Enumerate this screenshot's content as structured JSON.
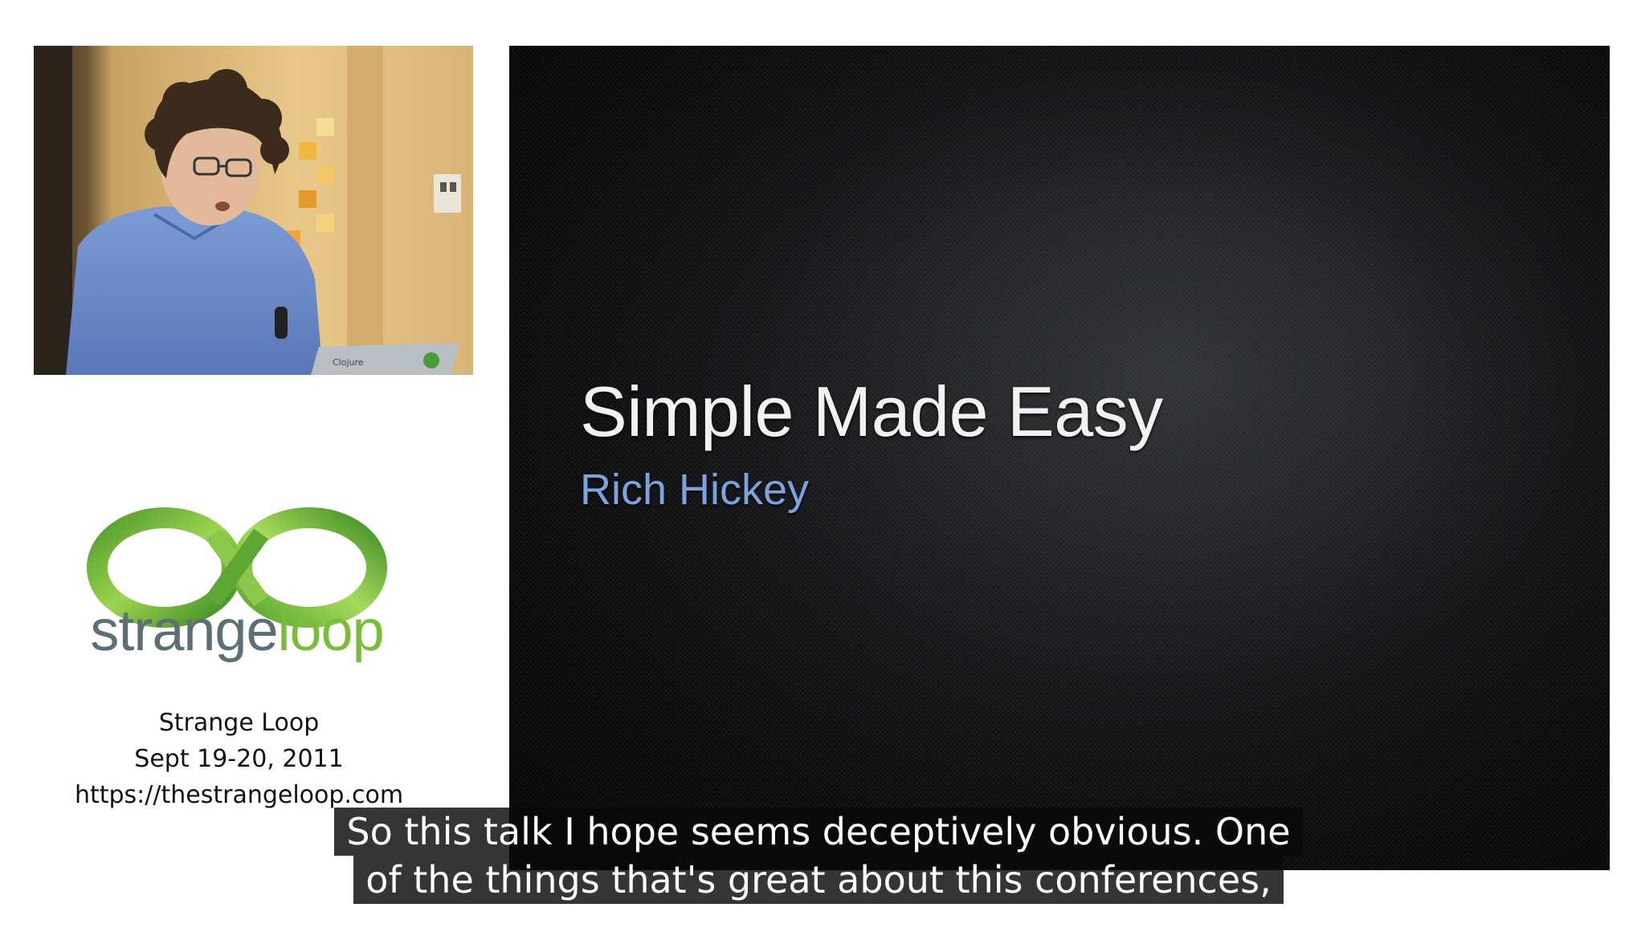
{
  "speaker_video": {
    "laptop_sticker": "Clojure"
  },
  "logo": {
    "word_part1": "strange",
    "word_part2": "loop"
  },
  "event_info": {
    "line1": "Strange Loop",
    "line2": "Sept 19-20, 2011",
    "line3": "https://thestrangeloop.com"
  },
  "slide": {
    "title": "Simple Made Easy",
    "subtitle": "Rich Hickey"
  },
  "captions": {
    "line1": "So this talk I hope seems deceptively obvious. One",
    "line2": "of the things that's great about this conferences,"
  },
  "colors": {
    "logo_green": "#7bbd3b",
    "logo_gray": "#5c6f75",
    "subtitle_blue": "#7ea2dc",
    "caption_bg": "#080808"
  }
}
